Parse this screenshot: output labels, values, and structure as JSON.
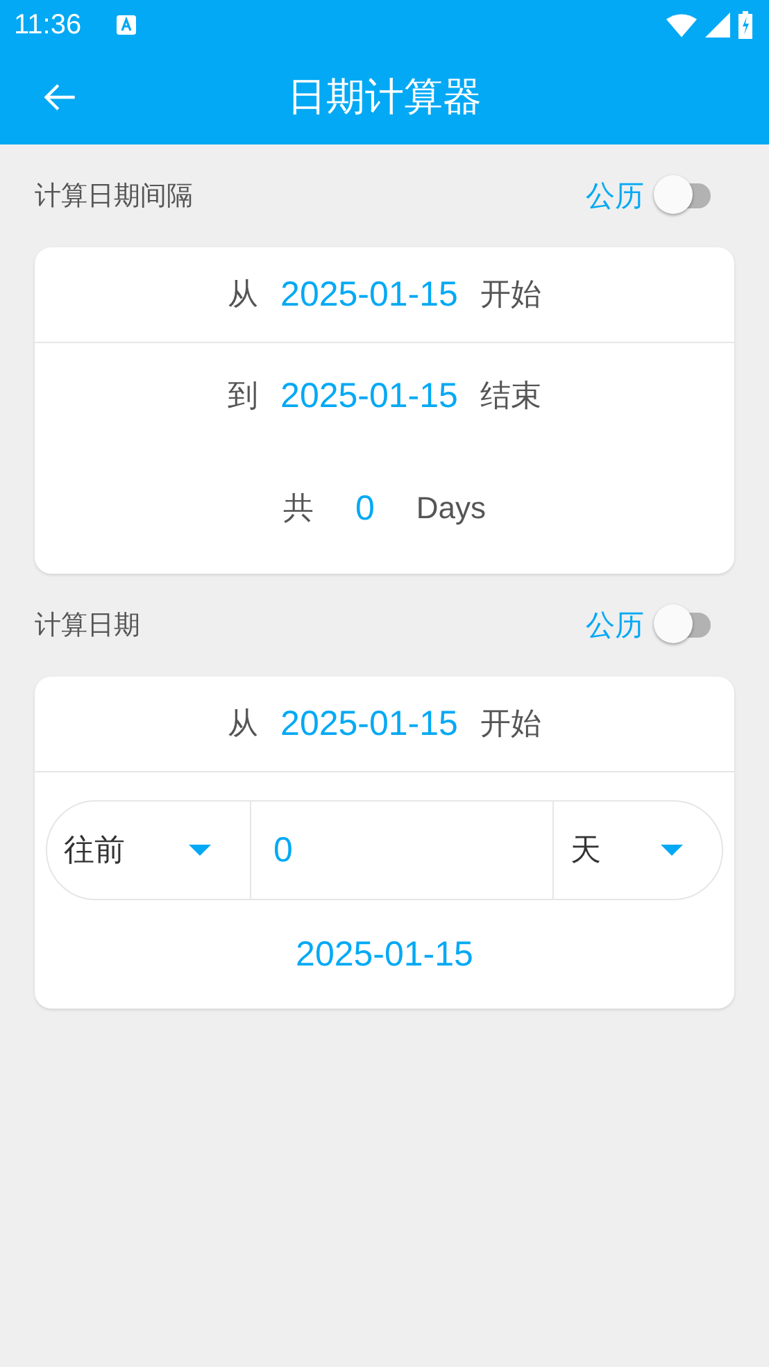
{
  "status_bar": {
    "time": "11:36"
  },
  "app_bar": {
    "title": "日期计算器"
  },
  "sections": [
    {
      "kind": "interval",
      "title": "计算日期间隔",
      "calendar_label": "公历",
      "calendar_switch_on": false,
      "from": {
        "prefix": "从",
        "date": "2025-01-15",
        "suffix": "开始"
      },
      "to": {
        "prefix": "到",
        "date": "2025-01-15",
        "suffix": "结束"
      },
      "total": {
        "prefix": "共",
        "value": "0",
        "unit": "Days"
      }
    },
    {
      "kind": "offset",
      "title": "计算日期",
      "calendar_label": "公历",
      "calendar_switch_on": false,
      "from": {
        "prefix": "从",
        "date": "2025-01-15",
        "suffix": "开始"
      },
      "direction": "往前",
      "amount": "0",
      "unit": "天",
      "result": "2025-01-15"
    }
  ]
}
